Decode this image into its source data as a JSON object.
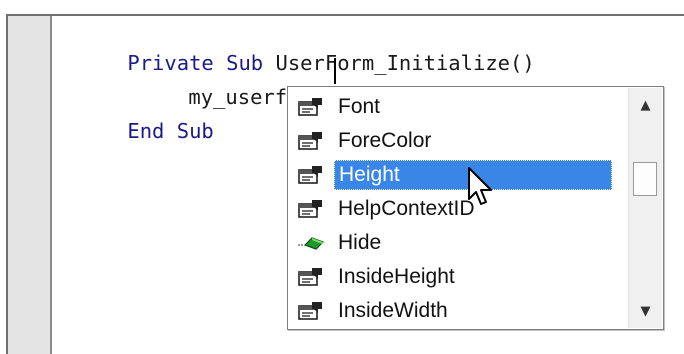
{
  "editor": {
    "code": {
      "line1": {
        "kw1": "Private",
        "kw2": "Sub",
        "rest": "UserForm_Initialize()"
      },
      "line2": {
        "text": "my_userform."
      },
      "line3": {
        "kw1": "End",
        "kw2": "Sub"
      }
    }
  },
  "autocomplete": {
    "items": [
      {
        "label": "Font",
        "icon": "property-icon"
      },
      {
        "label": "ForeColor",
        "icon": "property-icon"
      },
      {
        "label": "Height",
        "icon": "property-icon",
        "selected": true
      },
      {
        "label": "HelpContextID",
        "icon": "property-icon"
      },
      {
        "label": "Hide",
        "icon": "method-icon"
      },
      {
        "label": "InsideHeight",
        "icon": "property-icon"
      },
      {
        "label": "InsideWidth",
        "icon": "property-icon"
      }
    ],
    "selected_index": 2,
    "scrollbar": {
      "up_glyph": "▲",
      "down_glyph": "▼"
    }
  },
  "colors": {
    "keyword": "#1a1a8a",
    "selection": "#3a86e6",
    "gutter": "#e4e4e4"
  },
  "cursor": {
    "icon": "mouse-pointer-icon"
  }
}
